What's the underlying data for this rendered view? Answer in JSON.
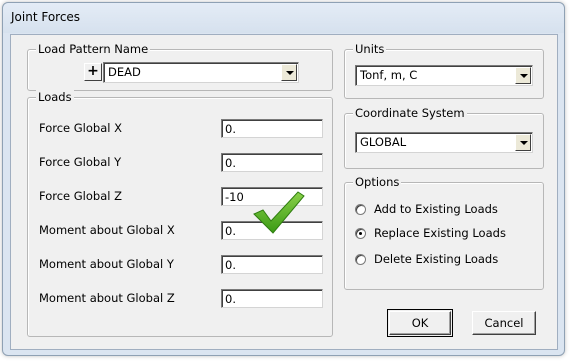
{
  "window": {
    "title": "Joint Forces"
  },
  "load_pattern": {
    "legend": "Load Pattern Name",
    "plus_label": "+",
    "value": "DEAD"
  },
  "units": {
    "legend": "Units",
    "value": "Tonf, m, C"
  },
  "loads": {
    "legend": "Loads",
    "rows": [
      {
        "label": "Force Global X",
        "value": "0."
      },
      {
        "label": "Force Global Y",
        "value": "0."
      },
      {
        "label": "Force Global Z",
        "value": "-10"
      },
      {
        "label": "Moment about Global X",
        "value": "0."
      },
      {
        "label": "Moment about Global Y",
        "value": "0."
      },
      {
        "label": "Moment about Global Z",
        "value": "0."
      }
    ]
  },
  "coordinate_system": {
    "legend": "Coordinate System",
    "value": "GLOBAL"
  },
  "options": {
    "legend": "Options",
    "items": [
      {
        "label": "Add to Existing Loads",
        "checked": false
      },
      {
        "label": "Replace Existing Loads",
        "checked": true
      },
      {
        "label": "Delete Existing Loads",
        "checked": false
      }
    ]
  },
  "buttons": {
    "ok": "OK",
    "cancel": "Cancel"
  },
  "annotation": {
    "icon": "checkmark-icon",
    "color": "#4caf1e"
  }
}
